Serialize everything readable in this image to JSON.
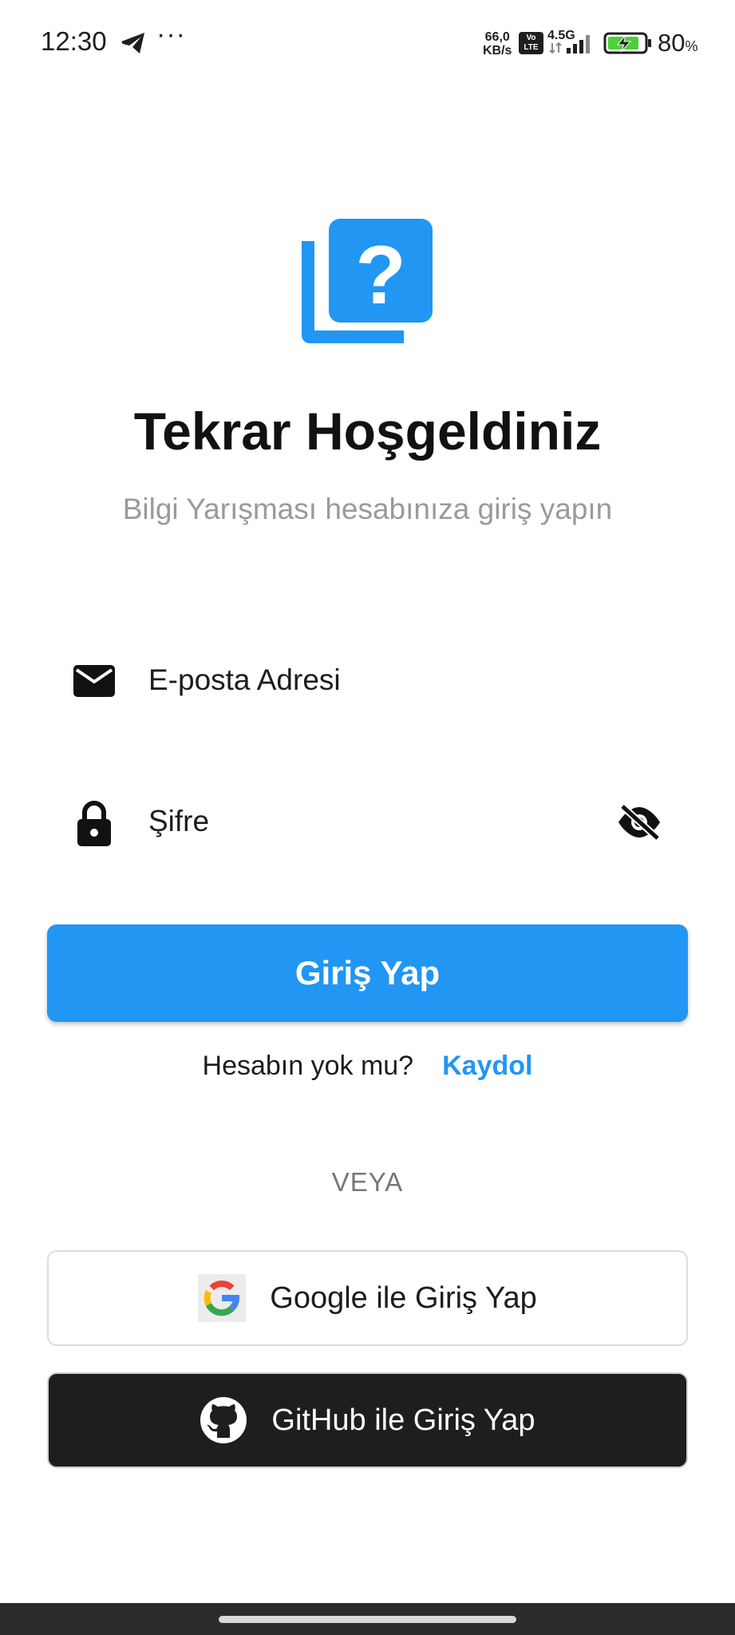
{
  "status_bar": {
    "time": "12:30",
    "more": "···",
    "net_speed_value": "66,0",
    "net_speed_unit": "KB/s",
    "volte_top": "Vo",
    "volte_bottom": "LTE",
    "network_type": "4.5G",
    "battery_percent": "80",
    "battery_unit": "%",
    "icons": [
      "telegram-icon",
      "volte-icon",
      "signal-icon",
      "battery-charging-icon"
    ]
  },
  "header": {
    "logo_icon": "quiz-question-icon",
    "title": "Tekrar Hoşgeldiniz",
    "subtitle": "Bilgi Yarışması hesabınıza giriş yapın"
  },
  "form": {
    "email_placeholder": "E-posta Adresi",
    "email_icon": "mail-icon",
    "password_placeholder": "Şifre",
    "password_icon": "lock-icon",
    "visibility_icon": "visibility-off-icon",
    "login_label": "Giriş Yap"
  },
  "signup": {
    "text": "Hesabın yok mu?",
    "link": "Kaydol"
  },
  "divider": "VEYA",
  "social": {
    "google_label": "Google ile Giriş Yap",
    "github_label": "GitHub ile Giriş Yap"
  },
  "colors": {
    "primary": "#2196f3",
    "github_bg": "#1e1e1e",
    "subtitle": "#9a9a9a"
  }
}
